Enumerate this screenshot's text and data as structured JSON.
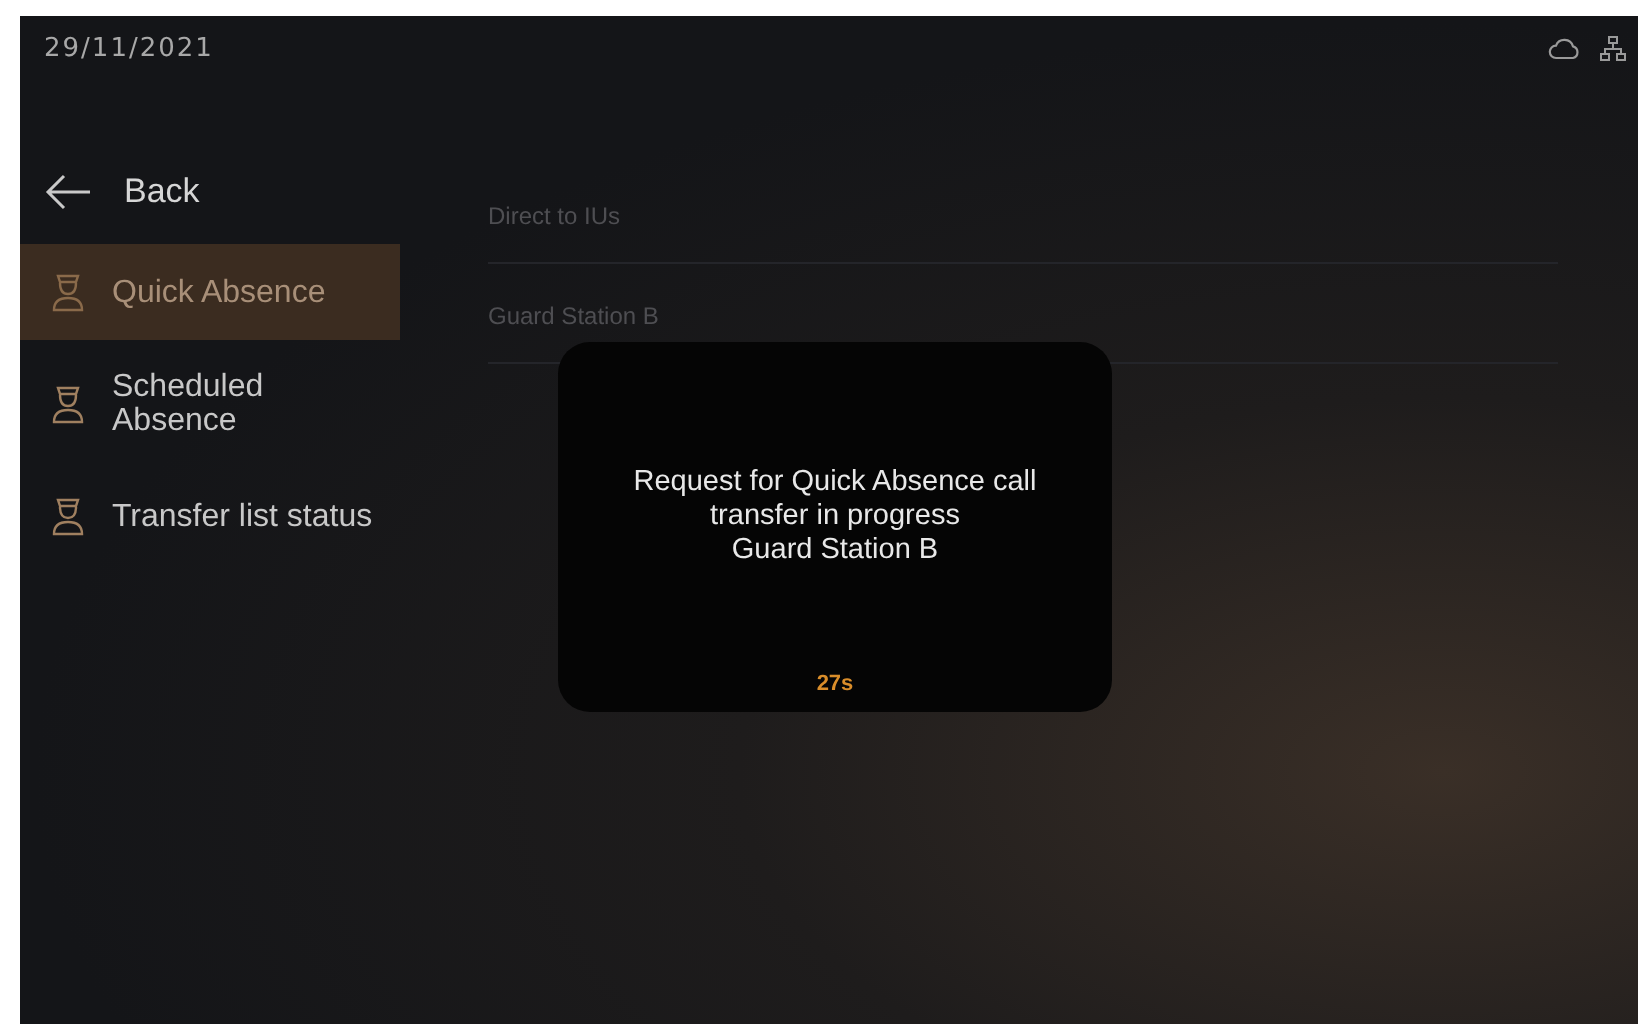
{
  "status_bar": {
    "date": "29/11/2021"
  },
  "back": {
    "label": "Back"
  },
  "sidebar": {
    "items": [
      {
        "label": "Quick Absence",
        "selected": true
      },
      {
        "label": "Scheduled Absence",
        "selected": false
      },
      {
        "label": "Transfer list status",
        "selected": false
      }
    ]
  },
  "list": {
    "items": [
      {
        "label": "Direct to IUs"
      },
      {
        "label": "Guard Station B"
      }
    ]
  },
  "dialog": {
    "message": "Request for Quick Absence call transfer in progress",
    "target": "Guard Station B",
    "countdown": "27s"
  }
}
